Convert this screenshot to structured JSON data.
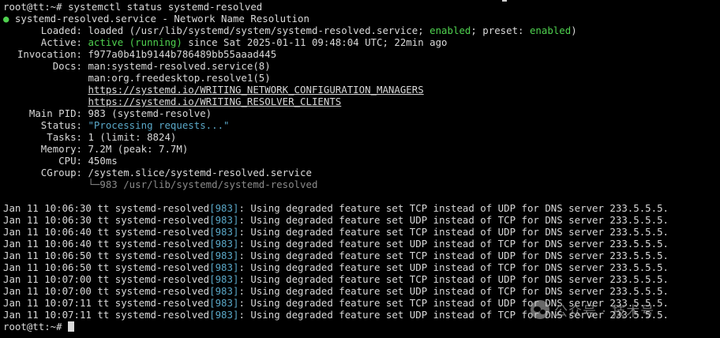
{
  "prompt1": "root@tt:~# ",
  "command": "systemctl status systemd-resolved",
  "header": {
    "dot": "●",
    "unit": " systemd-resolved.service - Network Name Resolution"
  },
  "loaded": {
    "label": "Loaded:",
    "a": "loaded (/usr/lib/systemd/system/systemd-resolved.service; ",
    "enabled": "enabled",
    "b": "; preset: ",
    "preset": "enabled",
    "c": ")"
  },
  "active": {
    "label": "Active:",
    "state": "active (running)",
    "rest": " since Sat 2025-01-11 09:48:04 UTC; 22min ago"
  },
  "invocation": {
    "label": "Invocation:",
    "value": "f977a0b41b9144b786489bb55aaad445"
  },
  "docs": {
    "label": "Docs:",
    "items": [
      "man:systemd-resolved.service(8)",
      "man:org.freedesktop.resolve1(5)",
      "https://systemd.io/WRITING_NETWORK_CONFIGURATION_MANAGERS",
      "https://systemd.io/WRITING_RESOLVER_CLIENTS"
    ]
  },
  "mainpid": {
    "label": "Main PID:",
    "value": "983 (systemd-resolve)"
  },
  "status": {
    "label": "Status:",
    "value": "\"Processing requests...\""
  },
  "tasks": {
    "label": "Tasks:",
    "value": "1 (limit: 8824)"
  },
  "memory": {
    "label": "Memory:",
    "value": "7.2M (peak: 7.7M)"
  },
  "cpu": {
    "label": "CPU:",
    "value": "450ms"
  },
  "cgroup": {
    "label": "CGroup:",
    "value": "/system.slice/systemd-resolved.service",
    "child": "└─983 /usr/lib/systemd/systemd-resolved"
  },
  "logs": [
    {
      "time": "Jan 11 10:06:30",
      "host": "tt",
      "proc": "systemd-resolved",
      "pid": "[983]",
      "msg": ": Using degraded feature set TCP instead of UDP for DNS server 233.5.5.5."
    },
    {
      "time": "Jan 11 10:06:30",
      "host": "tt",
      "proc": "systemd-resolved",
      "pid": "[983]",
      "msg": ": Using degraded feature set UDP instead of TCP for DNS server 233.5.5.5."
    },
    {
      "time": "Jan 11 10:06:40",
      "host": "tt",
      "proc": "systemd-resolved",
      "pid": "[983]",
      "msg": ": Using degraded feature set TCP instead of UDP for DNS server 233.5.5.5."
    },
    {
      "time": "Jan 11 10:06:40",
      "host": "tt",
      "proc": "systemd-resolved",
      "pid": "[983]",
      "msg": ": Using degraded feature set UDP instead of TCP for DNS server 233.5.5.5."
    },
    {
      "time": "Jan 11 10:06:50",
      "host": "tt",
      "proc": "systemd-resolved",
      "pid": "[983]",
      "msg": ": Using degraded feature set TCP instead of UDP for DNS server 233.5.5.5."
    },
    {
      "time": "Jan 11 10:06:50",
      "host": "tt",
      "proc": "systemd-resolved",
      "pid": "[983]",
      "msg": ": Using degraded feature set UDP instead of TCP for DNS server 233.5.5.5."
    },
    {
      "time": "Jan 11 10:07:00",
      "host": "tt",
      "proc": "systemd-resolved",
      "pid": "[983]",
      "msg": ": Using degraded feature set TCP instead of UDP for DNS server 233.5.5.5."
    },
    {
      "time": "Jan 11 10:07:00",
      "host": "tt",
      "proc": "systemd-resolved",
      "pid": "[983]",
      "msg": ": Using degraded feature set UDP instead of TCP for DNS server 233.5.5.5."
    },
    {
      "time": "Jan 11 10:07:11",
      "host": "tt",
      "proc": "systemd-resolved",
      "pid": "[983]",
      "msg": ": Using degraded feature set TCP instead of UDP for DNS server 233.5.5.5."
    },
    {
      "time": "Jan 11 10:07:11",
      "host": "tt",
      "proc": "systemd-resolved",
      "pid": "[983]",
      "msg": ": Using degraded feature set UDP instead of TCP for DNS server 233.5.5.5."
    }
  ],
  "prompt2": "root@tt:~# ",
  "watermark": {
    "text": "公众号 · 技术号",
    "icon": "wechat-logo-icon"
  },
  "colors": {
    "background": "#000000",
    "text": "#d9d9d9",
    "active_green": "#4fd14f",
    "pid_cyan": "#5aa8c8",
    "dim": "#8a8a8a"
  }
}
